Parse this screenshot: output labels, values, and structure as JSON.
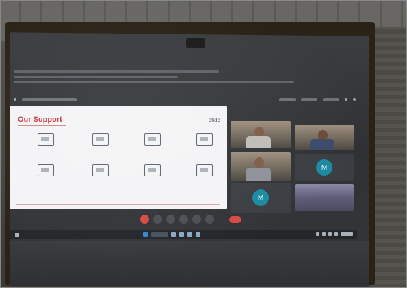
{
  "slide": {
    "title": "Our Support",
    "logo_text": "dfidb"
  },
  "participants": {
    "avatar_initial_1": "M",
    "avatar_initial_2": "M"
  },
  "colors": {
    "accent_red": "#c8373a",
    "avatar_teal": "#1a8aa0",
    "end_call_red": "#d94843"
  }
}
